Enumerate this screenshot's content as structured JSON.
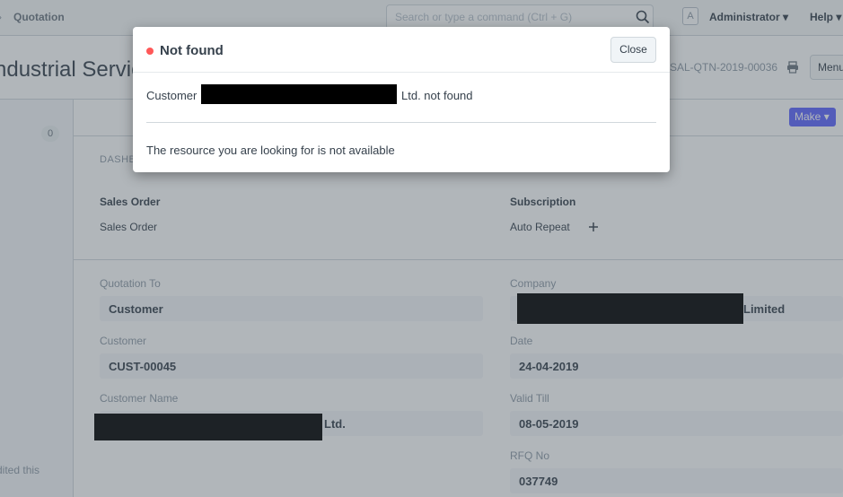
{
  "navbar": {
    "breadcrumb": "Quotation",
    "search_placeholder": "Search or type a command (Ctrl + G)",
    "avatar_letter": "A",
    "user_label": "Administrator",
    "help_label": "Help"
  },
  "page": {
    "title": "ndustrial Servic",
    "doc_name": "SAL-QTN-2019-00036",
    "menu_label": "Menu",
    "make_label": "Make"
  },
  "sidebar": {
    "count": "0",
    "edited_text": "dited this"
  },
  "dashboard": {
    "section_label": "DASHB",
    "groups": [
      {
        "heading": "Sales Order",
        "item": "Sales Order"
      },
      {
        "heading": "Subscription",
        "item": "Auto Repeat"
      }
    ]
  },
  "form": {
    "fields": {
      "quotation_to": {
        "label": "Quotation To",
        "value": "Customer"
      },
      "customer": {
        "label": "Customer",
        "value": "CUST-00045"
      },
      "customer_name": {
        "label": "Customer Name",
        "value_suffix": "Ltd."
      },
      "company": {
        "label": "Company",
        "value_suffix": "Limited"
      },
      "date": {
        "label": "Date",
        "value": "24-04-2019"
      },
      "valid_till": {
        "label": "Valid Till",
        "value": "08-05-2019"
      },
      "rfq_no": {
        "label": "RFQ No",
        "value": "037749"
      }
    }
  },
  "modal": {
    "title": "Not found",
    "close_label": "Close",
    "message_prefix": "Customer",
    "message_suffix": "Ltd. not found",
    "detail": "The resource you are looking for is not available",
    "indicator_color": "#ff5858"
  }
}
